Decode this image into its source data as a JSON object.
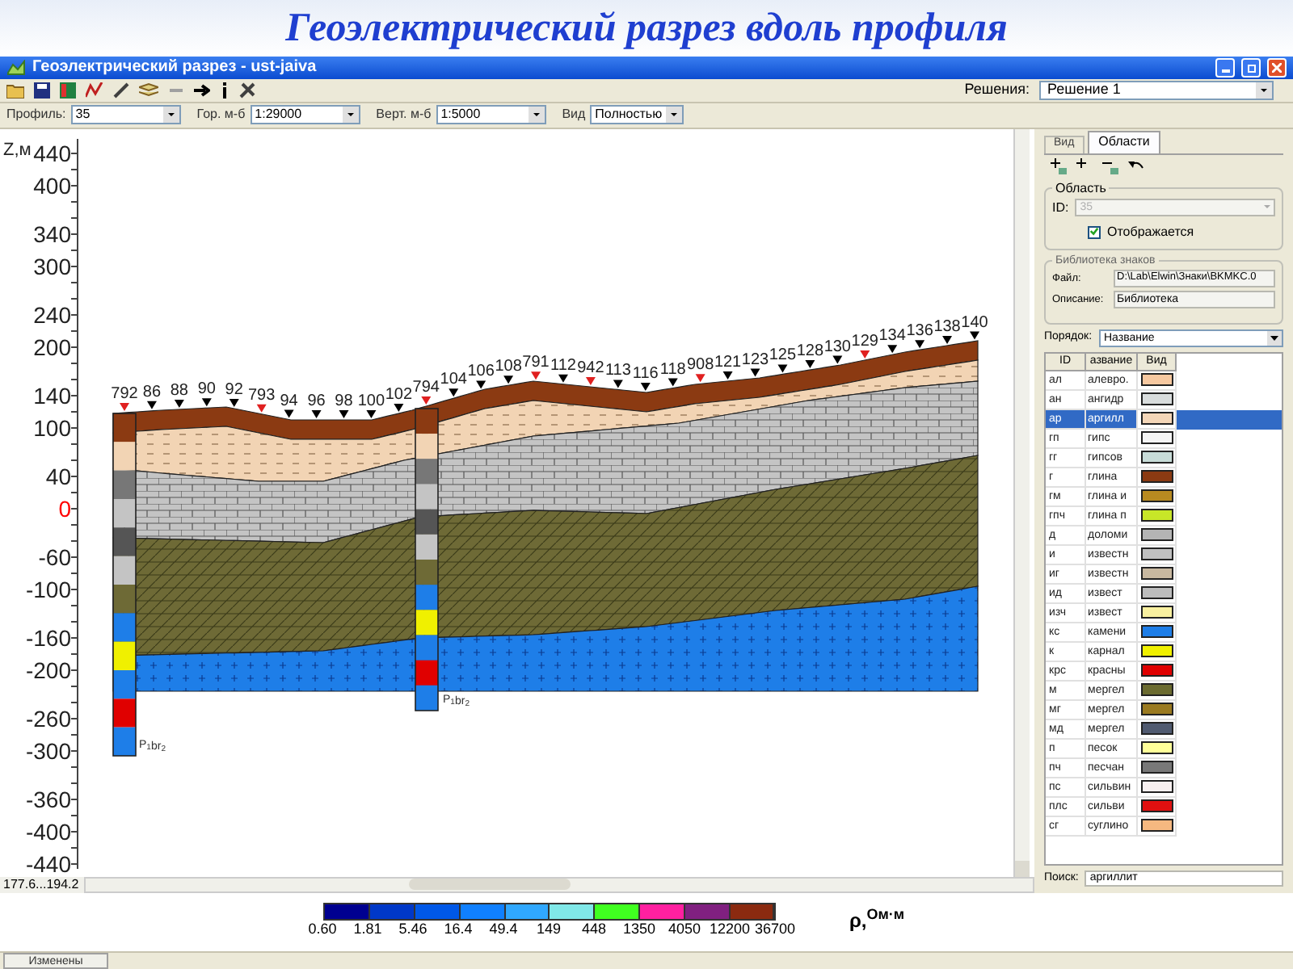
{
  "slide_title": "Геоэлектрический разрез вдоль профиля",
  "window": {
    "title": "Геоэлектрический разрез - ust-jaiva"
  },
  "solutions": {
    "label": "Решения:",
    "value": "Решение 1"
  },
  "view_settings": [
    {
      "label": "Профиль:",
      "value": "35"
    },
    {
      "label": "Гор. м-б",
      "value": "1:29000"
    },
    {
      "label": "Верт. м-б",
      "value": "1:5000"
    },
    {
      "label": "Вид",
      "value": "Полностью"
    }
  ],
  "section": {
    "axis_label": "Z,м",
    "yticks": [
      {
        "label": "440",
        "highlighted": false
      },
      {
        "label": "400",
        "highlighted": false
      },
      {
        "label": "340",
        "highlighted": false
      },
      {
        "label": "300",
        "highlighted": false
      },
      {
        "label": "240",
        "highlighted": false
      },
      {
        "label": "200",
        "highlighted": false
      },
      {
        "label": "140",
        "highlighted": false
      },
      {
        "label": "100",
        "highlighted": false
      },
      {
        "label": "40",
        "highlighted": false
      },
      {
        "label": "0",
        "highlighted": true
      },
      {
        "label": "-60",
        "highlighted": false
      },
      {
        "label": "-100",
        "highlighted": false
      },
      {
        "label": "-160",
        "highlighted": false
      },
      {
        "label": "-200",
        "highlighted": false
      },
      {
        "label": "-260",
        "highlighted": false
      },
      {
        "label": "-300",
        "highlighted": false
      },
      {
        "label": "-360",
        "highlighted": false
      },
      {
        "label": "-400",
        "highlighted": false
      },
      {
        "label": "-440",
        "highlighted": false
      }
    ],
    "stations": [
      {
        "label": "792",
        "kind": "borehole"
      },
      {
        "label": "86",
        "kind": "station"
      },
      {
        "label": "88",
        "kind": "station"
      },
      {
        "label": "90",
        "kind": "station"
      },
      {
        "label": "92",
        "kind": "station"
      },
      {
        "label": "793",
        "kind": "borehole"
      },
      {
        "label": "94",
        "kind": "station"
      },
      {
        "label": "96",
        "kind": "station"
      },
      {
        "label": "98",
        "kind": "station"
      },
      {
        "label": "100",
        "kind": "station"
      },
      {
        "label": "102",
        "kind": "station"
      },
      {
        "label": "794",
        "kind": "borehole"
      },
      {
        "label": "104",
        "kind": "station"
      },
      {
        "label": "106",
        "kind": "station"
      },
      {
        "label": "108",
        "kind": "station"
      },
      {
        "label": "791",
        "kind": "borehole"
      },
      {
        "label": "112",
        "kind": "station"
      },
      {
        "label": "942",
        "kind": "borehole"
      },
      {
        "label": "113",
        "kind": "station"
      },
      {
        "label": "116",
        "kind": "station"
      },
      {
        "label": "118",
        "kind": "station"
      },
      {
        "label": "908",
        "kind": "borehole"
      },
      {
        "label": "121",
        "kind": "station"
      },
      {
        "label": "123",
        "kind": "station"
      },
      {
        "label": "125",
        "kind": "station"
      },
      {
        "label": "128",
        "kind": "station"
      },
      {
        "label": "130",
        "kind": "station"
      },
      {
        "label": "129",
        "kind": "borehole"
      },
      {
        "label": "134",
        "kind": "station"
      },
      {
        "label": "136",
        "kind": "station"
      },
      {
        "label": "138",
        "kind": "station"
      },
      {
        "label": "140",
        "kind": "station"
      }
    ],
    "borehole_labels": [
      "P$_{1}$br$_{2}$",
      "P$_{1}$br$_{2}$"
    ],
    "range_label": "177.6...194.2"
  },
  "panel": {
    "tabs": [
      {
        "label": "Вид",
        "selected": false
      },
      {
        "label": "Области",
        "selected": true
      }
    ],
    "area_group": {
      "title": "Область",
      "id_label": "ID:",
      "id_value": "35",
      "id_disabled": true,
      "display_label": "Отображается",
      "display_checked": true
    },
    "library": {
      "title": "Библиотека знаков",
      "file_label": "Файл:",
      "file_value": "D:\\Lab\\Elwin\\Знаки\\BKMKC.0",
      "description_label": "Описание:",
      "description_value": "Библиотека"
    },
    "order": {
      "label": "Порядок:",
      "value": "Название"
    },
    "table": {
      "columns": [
        "ID",
        "азвание",
        "Вид"
      ],
      "rows": [
        {
          "id": "ал",
          "name": "алевро.",
          "color": "#f6c8a0",
          "selected": false
        },
        {
          "id": "ан",
          "name": "ангидр",
          "color": "#d8dcdc",
          "selected": false
        },
        {
          "id": "ар",
          "name": "аргилл",
          "color": "#f4d6b8",
          "selected": true
        },
        {
          "id": "гп",
          "name": "гипс",
          "color": "#f4f4f4",
          "selected": false
        },
        {
          "id": "гг",
          "name": "гипсов",
          "color": "#c8dcd8",
          "selected": false
        },
        {
          "id": "г",
          "name": "глина",
          "color": "#8b3a12",
          "selected": false
        },
        {
          "id": "гм",
          "name": "глина и",
          "color": "#b88a20",
          "selected": false
        },
        {
          "id": "гпч",
          "name": "глина п",
          "color": "#c8e628",
          "selected": false
        },
        {
          "id": "д",
          "name": "доломи",
          "color": "#b4b4b4",
          "selected": false
        },
        {
          "id": "и",
          "name": "известн",
          "color": "#c0c0c0",
          "selected": false
        },
        {
          "id": "иг",
          "name": "известн",
          "color": "#c8b8a0",
          "selected": false
        },
        {
          "id": "ид",
          "name": "извест",
          "color": "#bcbcbc",
          "selected": false
        },
        {
          "id": "изч",
          "name": "извест",
          "color": "#f8f0a0",
          "selected": false
        },
        {
          "id": "кс",
          "name": "камени",
          "color": "#1e7ee8",
          "selected": false
        },
        {
          "id": "к",
          "name": "карнал",
          "color": "#f0f000",
          "selected": false
        },
        {
          "id": "крс",
          "name": "красны",
          "color": "#e00000",
          "selected": false
        },
        {
          "id": "м",
          "name": "мергел",
          "color": "#6b6b30",
          "selected": false
        },
        {
          "id": "мг",
          "name": "мергел",
          "color": "#9a7a20",
          "selected": false
        },
        {
          "id": "мд",
          "name": "мергел",
          "color": "#505a70",
          "selected": false
        },
        {
          "id": "п",
          "name": "песок",
          "color": "#ffff99",
          "selected": false
        },
        {
          "id": "пч",
          "name": "песчан",
          "color": "#787878",
          "selected": false
        },
        {
          "id": "пс",
          "name": "сильвин",
          "color": "#f8f0f0",
          "selected": false
        },
        {
          "id": "плс",
          "name": "сильви",
          "color": "#e01010",
          "selected": false
        },
        {
          "id": "сг",
          "name": "суглино",
          "color": "#f5b880",
          "selected": false
        }
      ]
    },
    "search": {
      "label": "Поиск:",
      "value": "аргиллит"
    }
  },
  "color_scale": {
    "segments": [
      {
        "color": "#000090"
      },
      {
        "color": "#0038c8"
      },
      {
        "color": "#0058e8"
      },
      {
        "color": "#1080ff"
      },
      {
        "color": "#30a8ff"
      },
      {
        "color": "#80e8e8"
      },
      {
        "color": "#40ff20"
      },
      {
        "color": "#ff20a0"
      },
      {
        "color": "#802080"
      },
      {
        "color": "#8b2a10"
      }
    ],
    "labels": [
      "0.60",
      "1.81",
      "5.46",
      "16.4",
      "49.4",
      "149",
      "448",
      "1350",
      "4050",
      "12200",
      "36700"
    ],
    "unit": "ρ,$^{Ом·м}$"
  },
  "status_bar": {
    "tab": "Изменены"
  }
}
